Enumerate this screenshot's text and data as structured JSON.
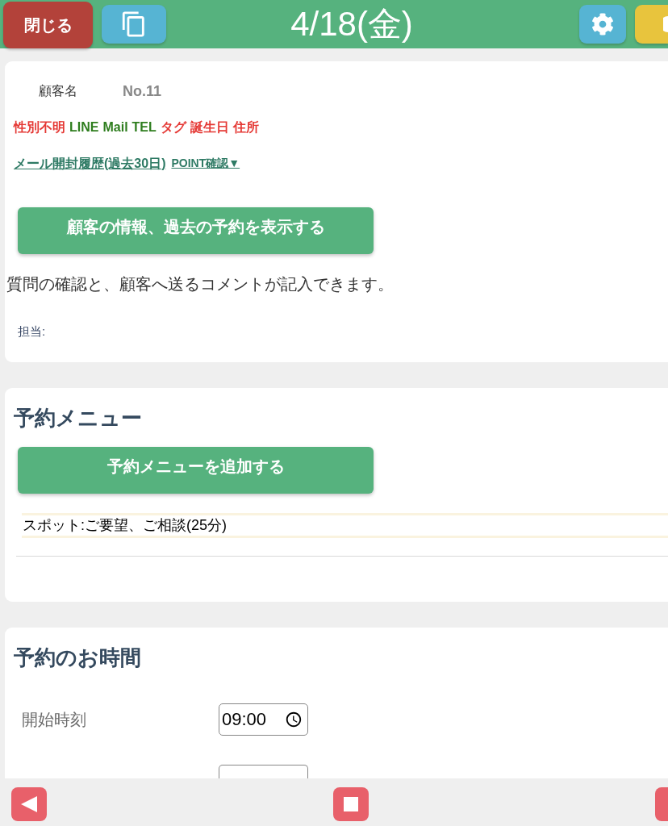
{
  "header": {
    "close_button": "閉じる",
    "title": "4/18(金)"
  },
  "customer": {
    "name_label": "顧客名",
    "name_value": "No.11",
    "tags": [
      {
        "label": "性別不明",
        "color": "#e53935"
      },
      {
        "label": "LINE",
        "color": "#2e7d1e"
      },
      {
        "label": "Mail",
        "color": "#2e7d1e"
      },
      {
        "label": "TEL",
        "color": "#2e7d1e"
      },
      {
        "label": "タグ",
        "color": "#e53935"
      },
      {
        "label": "誕生日",
        "color": "#e53935"
      },
      {
        "label": "住所",
        "color": "#e53935"
      }
    ],
    "links": [
      {
        "kind": "primary",
        "label": "メール開封履歴(過去30日)"
      },
      {
        "kind": "secondary",
        "label": "POINT確認▼"
      }
    ],
    "show_button": "顧客の情報、過去の予約を表示する",
    "note": "質問の確認と、顧客へ送るコメントが記入できます。",
    "staff_label": "担当:"
  },
  "menu": {
    "title": "予約メニュー",
    "add_button": "予約メニューを追加する",
    "items": [
      "スポット:ご要望、ご相談(25分)"
    ]
  },
  "time": {
    "title": "予約のお時間",
    "fields": [
      {
        "label": "開始時刻",
        "value": "09:00",
        "cut_off": false
      },
      {
        "cut_off": true
      }
    ]
  }
}
